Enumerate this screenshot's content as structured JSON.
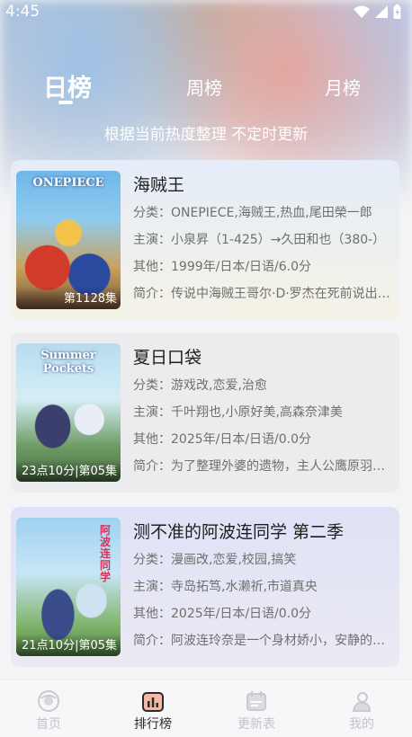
{
  "status_bar": {
    "time": "4:45"
  },
  "tabs": [
    {
      "label": "日榜",
      "active": true
    },
    {
      "label": "周榜",
      "active": false
    },
    {
      "label": "月榜",
      "active": false
    }
  ],
  "subtitle": "根据当前热度整理 不定时更新",
  "items": [
    {
      "title": "海贼王",
      "category": "分类：ONEPIECE,海贼王,热血,尾田榮一郎",
      "cast": "主演：小泉昇（1-425）→久田和也（380-）",
      "other": "其他：1999年/日本/日语/6.0分",
      "intro": "简介：传说中海贼王哥尔·D·罗杰在死前说出了宝藏",
      "poster_logo": "ONEPIECE",
      "poster_caption": "第1128集"
    },
    {
      "title": "夏日口袋",
      "category": "分类：游戏改,恋爱,治愈",
      "cast": "主演：千叶翔也,小原好美,高森奈津美",
      "other": "其他：2025年/日本/日语/0.0分",
      "intro": "简介：为了整理外婆的遗物，主人公鹰原羽依里",
      "poster_logo": "Summer Pockets",
      "poster_caption": "23点10分|第05集"
    },
    {
      "title": "测不准的阿波连同学 第二季",
      "category": "分类：漫画改,恋爱,校园,搞笑",
      "cast": "主演：寺岛拓笃,水濑祈,市道真央",
      "other": "其他：2025年/日本/日语/0.0分",
      "intro": "简介：阿波连玲奈是一个身材娇小，安静的女孩",
      "poster_logo": "阿波连同学",
      "poster_caption": "21点10分|第05集"
    }
  ],
  "nav": [
    {
      "label": "首页",
      "icon": "home-icon"
    },
    {
      "label": "排行榜",
      "icon": "chart-icon",
      "active": true
    },
    {
      "label": "更新表",
      "icon": "calendar-icon"
    },
    {
      "label": "我的",
      "icon": "profile-icon"
    }
  ],
  "colors": {
    "accent": "#f2a48a",
    "active_text": "#2a2a2a",
    "inactive_text": "#c3c3c8"
  }
}
